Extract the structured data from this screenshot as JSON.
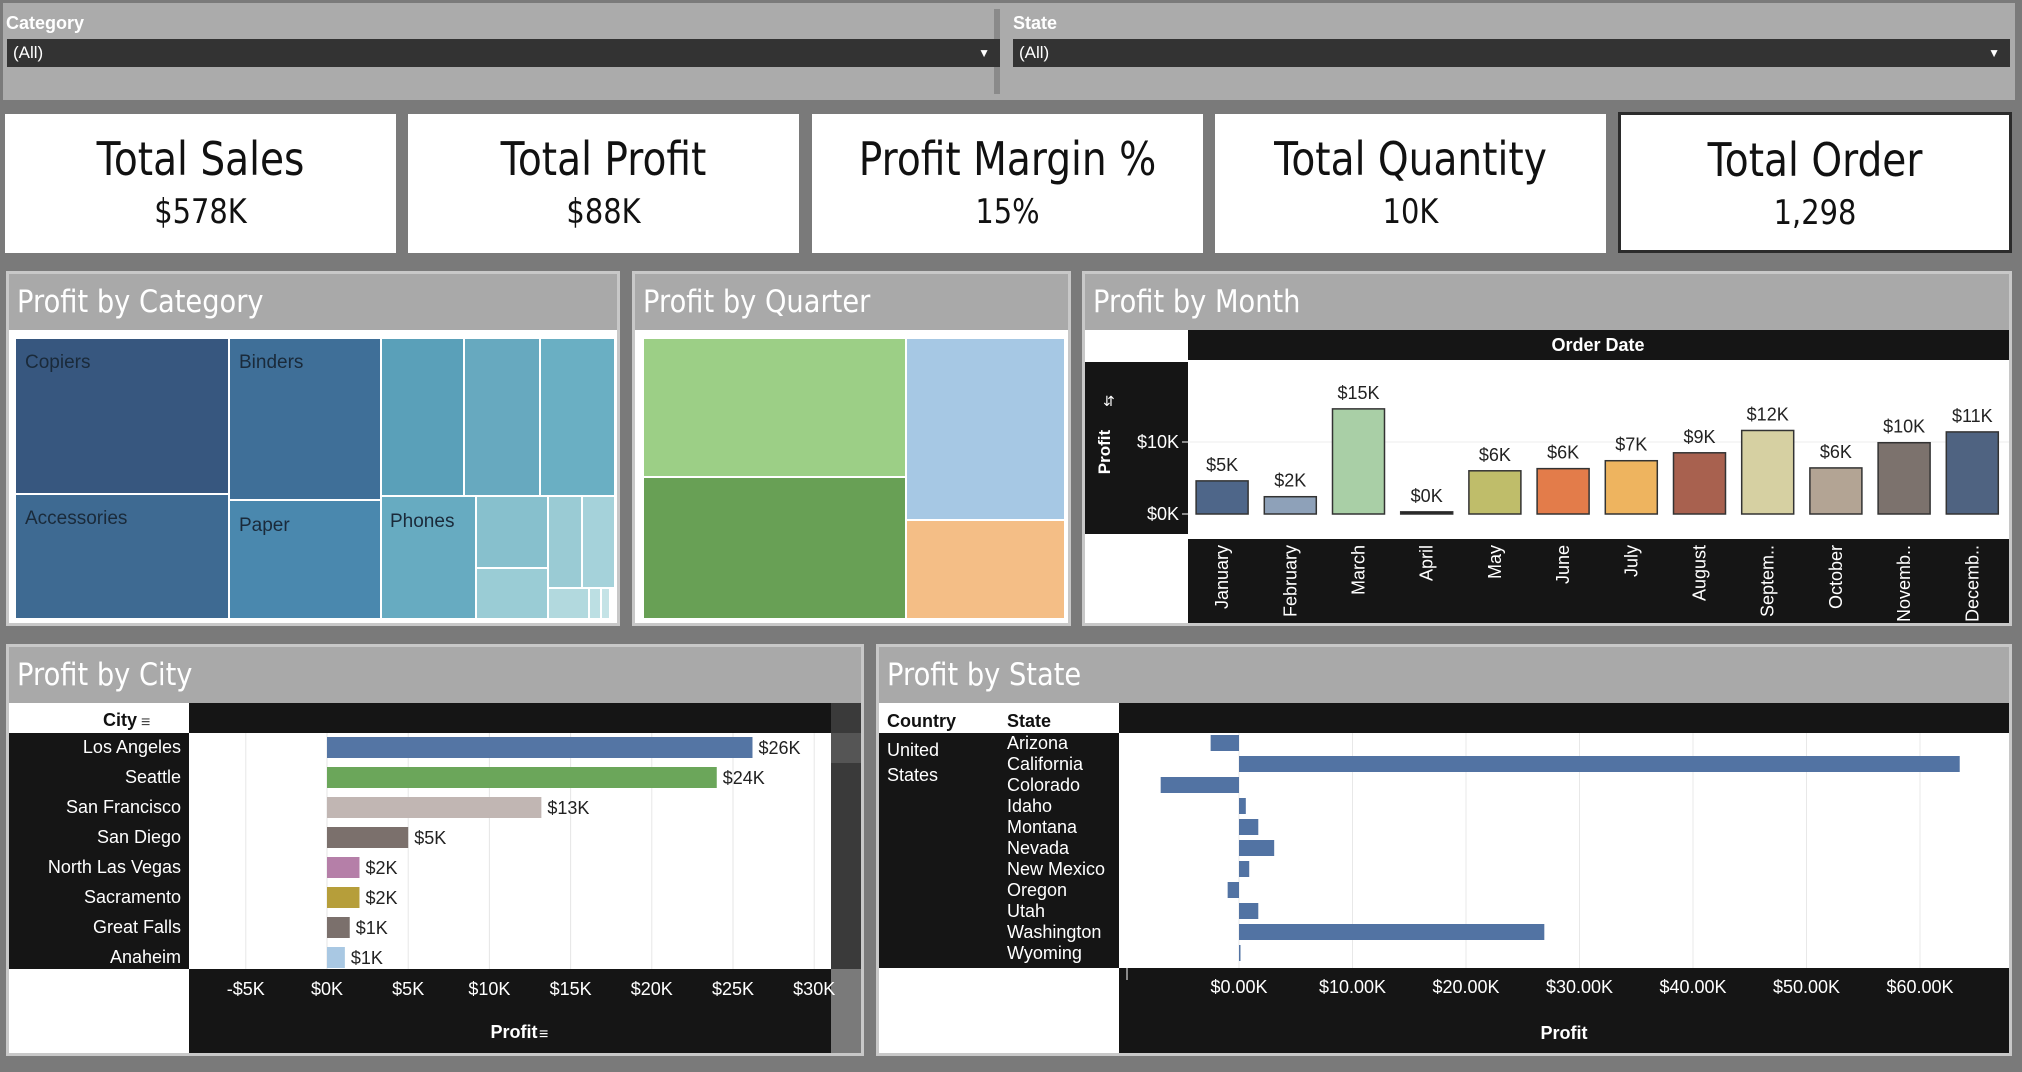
{
  "filters": [
    {
      "label": "Category",
      "value": "(All)"
    },
    {
      "label": "State",
      "value": "(All)"
    }
  ],
  "kpis": [
    {
      "title": "Total Sales",
      "value": "$578K"
    },
    {
      "title": "Total Profit",
      "value": "$88K"
    },
    {
      "title": "Profit Margin %",
      "value": "15%"
    },
    {
      "title": "Total Quantity",
      "value": "10K"
    },
    {
      "title": "Total Order",
      "value": "1,298"
    }
  ],
  "panels": {
    "category": "Profit by Category",
    "quarter": "Profit by Quarter",
    "month": "Profit by Month",
    "city": "Profit by City",
    "state": "Profit by State"
  },
  "treemap_labels": [
    "Copiers",
    "Binders",
    "Accessories",
    "Paper",
    "Phones"
  ],
  "colors": {
    "accent": "#4e6b94",
    "panel_title": "#a9a9a9",
    "dark": "#151515"
  },
  "chart_data": [
    {
      "type": "treemap",
      "title": "Profit by Category",
      "labels": [
        "Copiers",
        "Binders",
        "Accessories",
        "Paper",
        "Phones"
      ]
    },
    {
      "type": "treemap",
      "title": "Profit by Quarter",
      "colors": [
        "#9ccf86",
        "#68a055",
        "#a6c8e4",
        "#f4be86"
      ]
    },
    {
      "type": "bar",
      "title": "Profit by Month",
      "column_header": "Order Date",
      "ylabel": "Profit",
      "yticks": [
        "$10K",
        "$0K"
      ],
      "categories": [
        "January",
        "February",
        "March",
        "April",
        "May",
        "June",
        "July",
        "August",
        "Septem..",
        "October",
        "Novemb..",
        "Decemb.."
      ],
      "values": [
        4.6,
        2.4,
        14.6,
        0.3,
        6,
        6.3,
        7.4,
        8.5,
        11.6,
        6.4,
        9.9,
        11.4
      ],
      "labels": [
        "$5K",
        "$2K",
        "$15K",
        "$0K",
        "$6K",
        "$6K",
        "$7K",
        "$9K",
        "$12K",
        "$6K",
        "$10K",
        "$11K"
      ],
      "colors": [
        "#4e6689",
        "#8ea1b9",
        "#a9cfa6",
        "#1a1a1a",
        "#bfbd6a",
        "#e37c4a",
        "#eeb45f",
        "#a8614f",
        "#d6d0a2",
        "#b3a494",
        "#7c726d",
        "#4f6381"
      ]
    },
    {
      "type": "bar",
      "orientation": "horizontal",
      "title": "Profit by City",
      "row_header": "City",
      "xlabel": "Profit",
      "xticks": [
        "-$5K",
        "$0K",
        "$5K",
        "$10K",
        "$15K",
        "$20K",
        "$25K",
        "$30K"
      ],
      "categories": [
        "Los Angeles",
        "Seattle",
        "San Francisco",
        "San Diego",
        "North Las Vegas",
        "Sacramento",
        "Great Falls",
        "Anaheim"
      ],
      "values": [
        26.2,
        24,
        13.2,
        5,
        2,
        2,
        1.4,
        1.1
      ],
      "labels": [
        "$26K",
        "$24K",
        "$13K",
        "$5K",
        "$2K",
        "$2K",
        "$1K",
        "$1K"
      ],
      "colors": [
        "#5475a4",
        "#6ba65a",
        "#c1b6b3",
        "#7b706c",
        "#b57fa8",
        "#b69e3a",
        "#7b706c",
        "#a9c8e3"
      ]
    },
    {
      "type": "bar",
      "orientation": "horizontal",
      "title": "Profit by State",
      "row_headers": [
        "Country",
        "State"
      ],
      "country": "United States",
      "xlabel": "Profit",
      "xticks": [
        "$0.00K",
        "$10.00K",
        "$20.00K",
        "$30.00K",
        "$40.00K",
        "$50.00K",
        "$60.00K"
      ],
      "categories": [
        "Arizona",
        "California",
        "Colorado",
        "Idaho",
        "Montana",
        "Nevada",
        "New Mexico",
        "Oregon",
        "Utah",
        "Washington",
        "Wyoming"
      ],
      "values": [
        -2.5,
        63.5,
        -6.9,
        0.6,
        1.7,
        3.1,
        0.9,
        -1,
        1.7,
        26.9,
        0.1
      ],
      "color": "#5273a3"
    }
  ]
}
